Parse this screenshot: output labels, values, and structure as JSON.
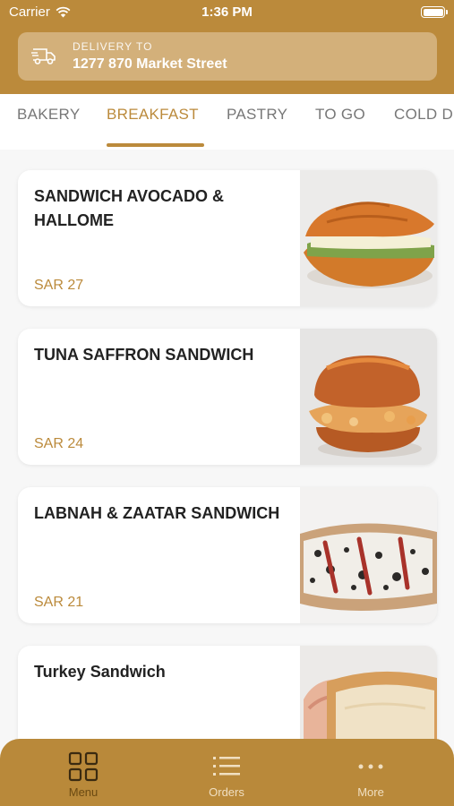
{
  "status_bar": {
    "carrier": "Carrier",
    "time": "1:36 PM"
  },
  "delivery": {
    "label": "DELIVERY TO",
    "address": "1277 870 Market Street",
    "icon": "delivery-truck-icon"
  },
  "tabs": [
    {
      "label": "BAKERY"
    },
    {
      "label": "BREAKFAST",
      "active": true
    },
    {
      "label": "PASTRY"
    },
    {
      "label": "TO GO"
    },
    {
      "label": "COLD D"
    }
  ],
  "products": [
    {
      "name": "SANDWICH AVOCADO & HALLOME",
      "price": "SAR 27"
    },
    {
      "name": "TUNA SAFFRON SANDWICH",
      "price": "SAR 24"
    },
    {
      "name": "LABNAH & ZAATAR SANDWICH",
      "price": "SAR 21"
    },
    {
      "name": "Turkey Sandwich",
      "price": ""
    }
  ],
  "bottom_nav": [
    {
      "label": "Menu",
      "icon": "grid-icon",
      "active": true
    },
    {
      "label": "Orders",
      "icon": "list-icon"
    },
    {
      "label": "More",
      "icon": "more-dots-icon"
    }
  ],
  "colors": {
    "brand": "#bb8a3b",
    "background": "#f7f7f7"
  }
}
